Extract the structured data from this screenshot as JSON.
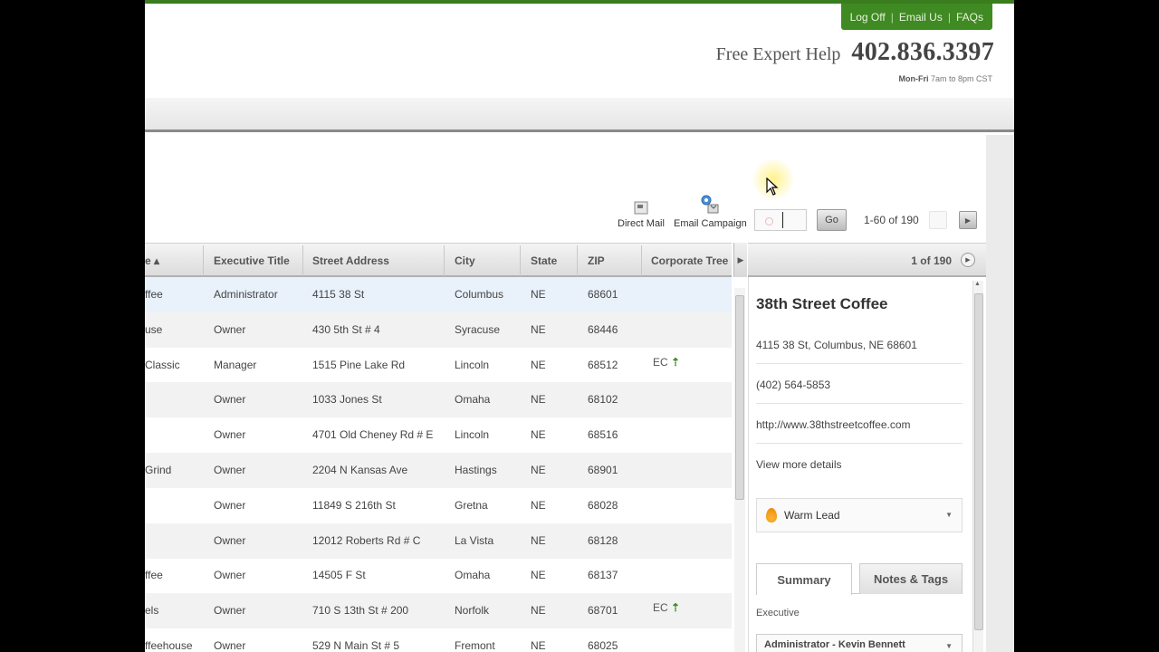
{
  "header": {
    "links": [
      "Log Off",
      "Email Us",
      "FAQs"
    ],
    "separator": "|",
    "help_label": "Free Expert Help",
    "help_phone": "402.836.3397",
    "hours_days": "Mon-Fri",
    "hours_time": "7am to 8pm CST"
  },
  "toolbar": {
    "direct_mail": "Direct Mail",
    "email_campaign": "Email Campaign",
    "go_label": "Go",
    "range_text": "1-60 of 190"
  },
  "grid": {
    "columns": [
      "e ▴",
      "Executive Title",
      "Street Address",
      "City",
      "State",
      "ZIP",
      "Corporate Tree"
    ],
    "rows": [
      {
        "name": "ffee",
        "title": "Administrator",
        "address": "4115 38 St",
        "city": "Columbus",
        "state": "NE",
        "zip": "68601",
        "tree": ""
      },
      {
        "name": "use",
        "title": "Owner",
        "address": "430 5th St # 4",
        "city": "Syracuse",
        "state": "NE",
        "zip": "68446",
        "tree": ""
      },
      {
        "name": "Classic",
        "title": "Manager",
        "address": "1515 Pine Lake Rd",
        "city": "Lincoln",
        "state": "NE",
        "zip": "68512",
        "tree": "EC"
      },
      {
        "name": "",
        "title": "Owner",
        "address": "1033 Jones St",
        "city": "Omaha",
        "state": "NE",
        "zip": "68102",
        "tree": ""
      },
      {
        "name": "",
        "title": "Owner",
        "address": "4701 Old Cheney Rd # E",
        "city": "Lincoln",
        "state": "NE",
        "zip": "68516",
        "tree": ""
      },
      {
        "name": "Grind",
        "title": "Owner",
        "address": "2204 N Kansas Ave",
        "city": "Hastings",
        "state": "NE",
        "zip": "68901",
        "tree": ""
      },
      {
        "name": "",
        "title": "Owner",
        "address": "11849 S 216th St",
        "city": "Gretna",
        "state": "NE",
        "zip": "68028",
        "tree": ""
      },
      {
        "name": "",
        "title": "Owner",
        "address": "12012 Roberts Rd # C",
        "city": "La Vista",
        "state": "NE",
        "zip": "68128",
        "tree": ""
      },
      {
        "name": "ffee",
        "title": "Owner",
        "address": "14505 F St",
        "city": "Omaha",
        "state": "NE",
        "zip": "68137",
        "tree": ""
      },
      {
        "name": "els",
        "title": "Owner",
        "address": "710 S 13th St # 200",
        "city": "Norfolk",
        "state": "NE",
        "zip": "68701",
        "tree": "EC"
      },
      {
        "name": "ffeehouse",
        "title": "Owner",
        "address": "529 N Main St # 5",
        "city": "Fremont",
        "state": "NE",
        "zip": "68025",
        "tree": ""
      }
    ]
  },
  "detail": {
    "count": "1 of 190",
    "name": "38th Street Coffee",
    "address": "4115 38 St, Columbus, NE 68601",
    "phone": "(402) 564-5853",
    "website": "http://www.38thstreetcoffee.com",
    "more": "View more details",
    "lead_status": "Warm Lead",
    "tabs": [
      "Summary",
      "Notes & Tags"
    ],
    "executive_label": "Executive",
    "executive_value": "Administrator - Kevin Bennett"
  },
  "colors": {
    "brand_green": "#3f8a22",
    "accent_arrow": "#3a8a1e"
  }
}
